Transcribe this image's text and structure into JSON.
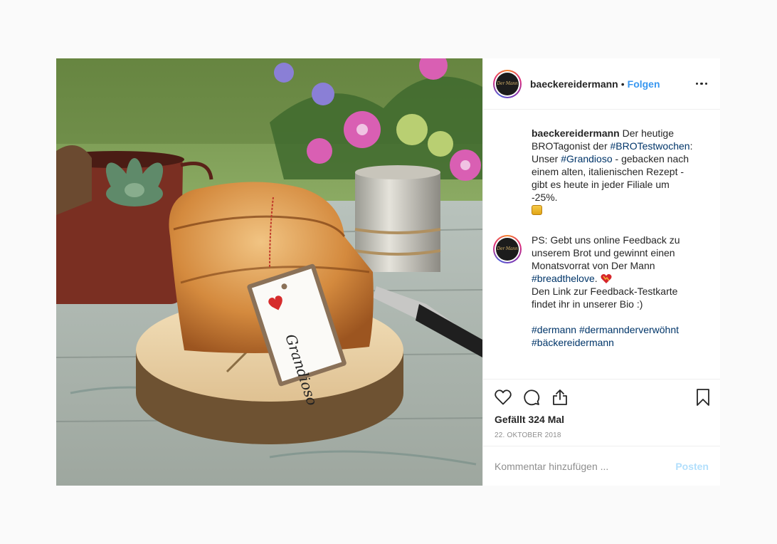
{
  "post": {
    "username": "baeckereidermann",
    "dot": "•",
    "follow_label": "Folgen",
    "avatar_text": "Der Mann",
    "photo_tag_text": "Grandioso",
    "caption": {
      "username": "baeckereidermann",
      "part1": " Der heutige BROTagonist der ",
      "tag1": "#BROTestwochen",
      "part2": ": Unser ",
      "tag2": "#Grandioso",
      "part3": " - gebacken nach einem alten, italienischen Rezept - gibt es heute in jeder Filiale um -25%."
    },
    "comment2": {
      "line1": "PS: Gebt uns online Feedback zu unserem Brot und gewinnt einen Monatsvorrat von Der Mann ",
      "tag": "#breadthelove",
      "after_tag": ". ",
      "line2": "Den Link zur Feedback-Testkarte findet ihr in unserer Bio :)",
      "tags": [
        "#dermann",
        "#dermannderverwöhnt",
        "#bäckereidermann"
      ]
    },
    "likes_label": "Gefällt 324 Mal",
    "date": "22. Oktober 2018",
    "comment_placeholder": "Kommentar hinzufügen ...",
    "post_button": "Posten"
  },
  "colors": {
    "link": "#3897f0",
    "hashtag": "#003569",
    "muted": "#8e8e8e",
    "post_disabled": "#b2dffc"
  },
  "icons": [
    "heart-icon",
    "comment-icon",
    "share-icon",
    "bookmark-icon",
    "more-icon"
  ]
}
